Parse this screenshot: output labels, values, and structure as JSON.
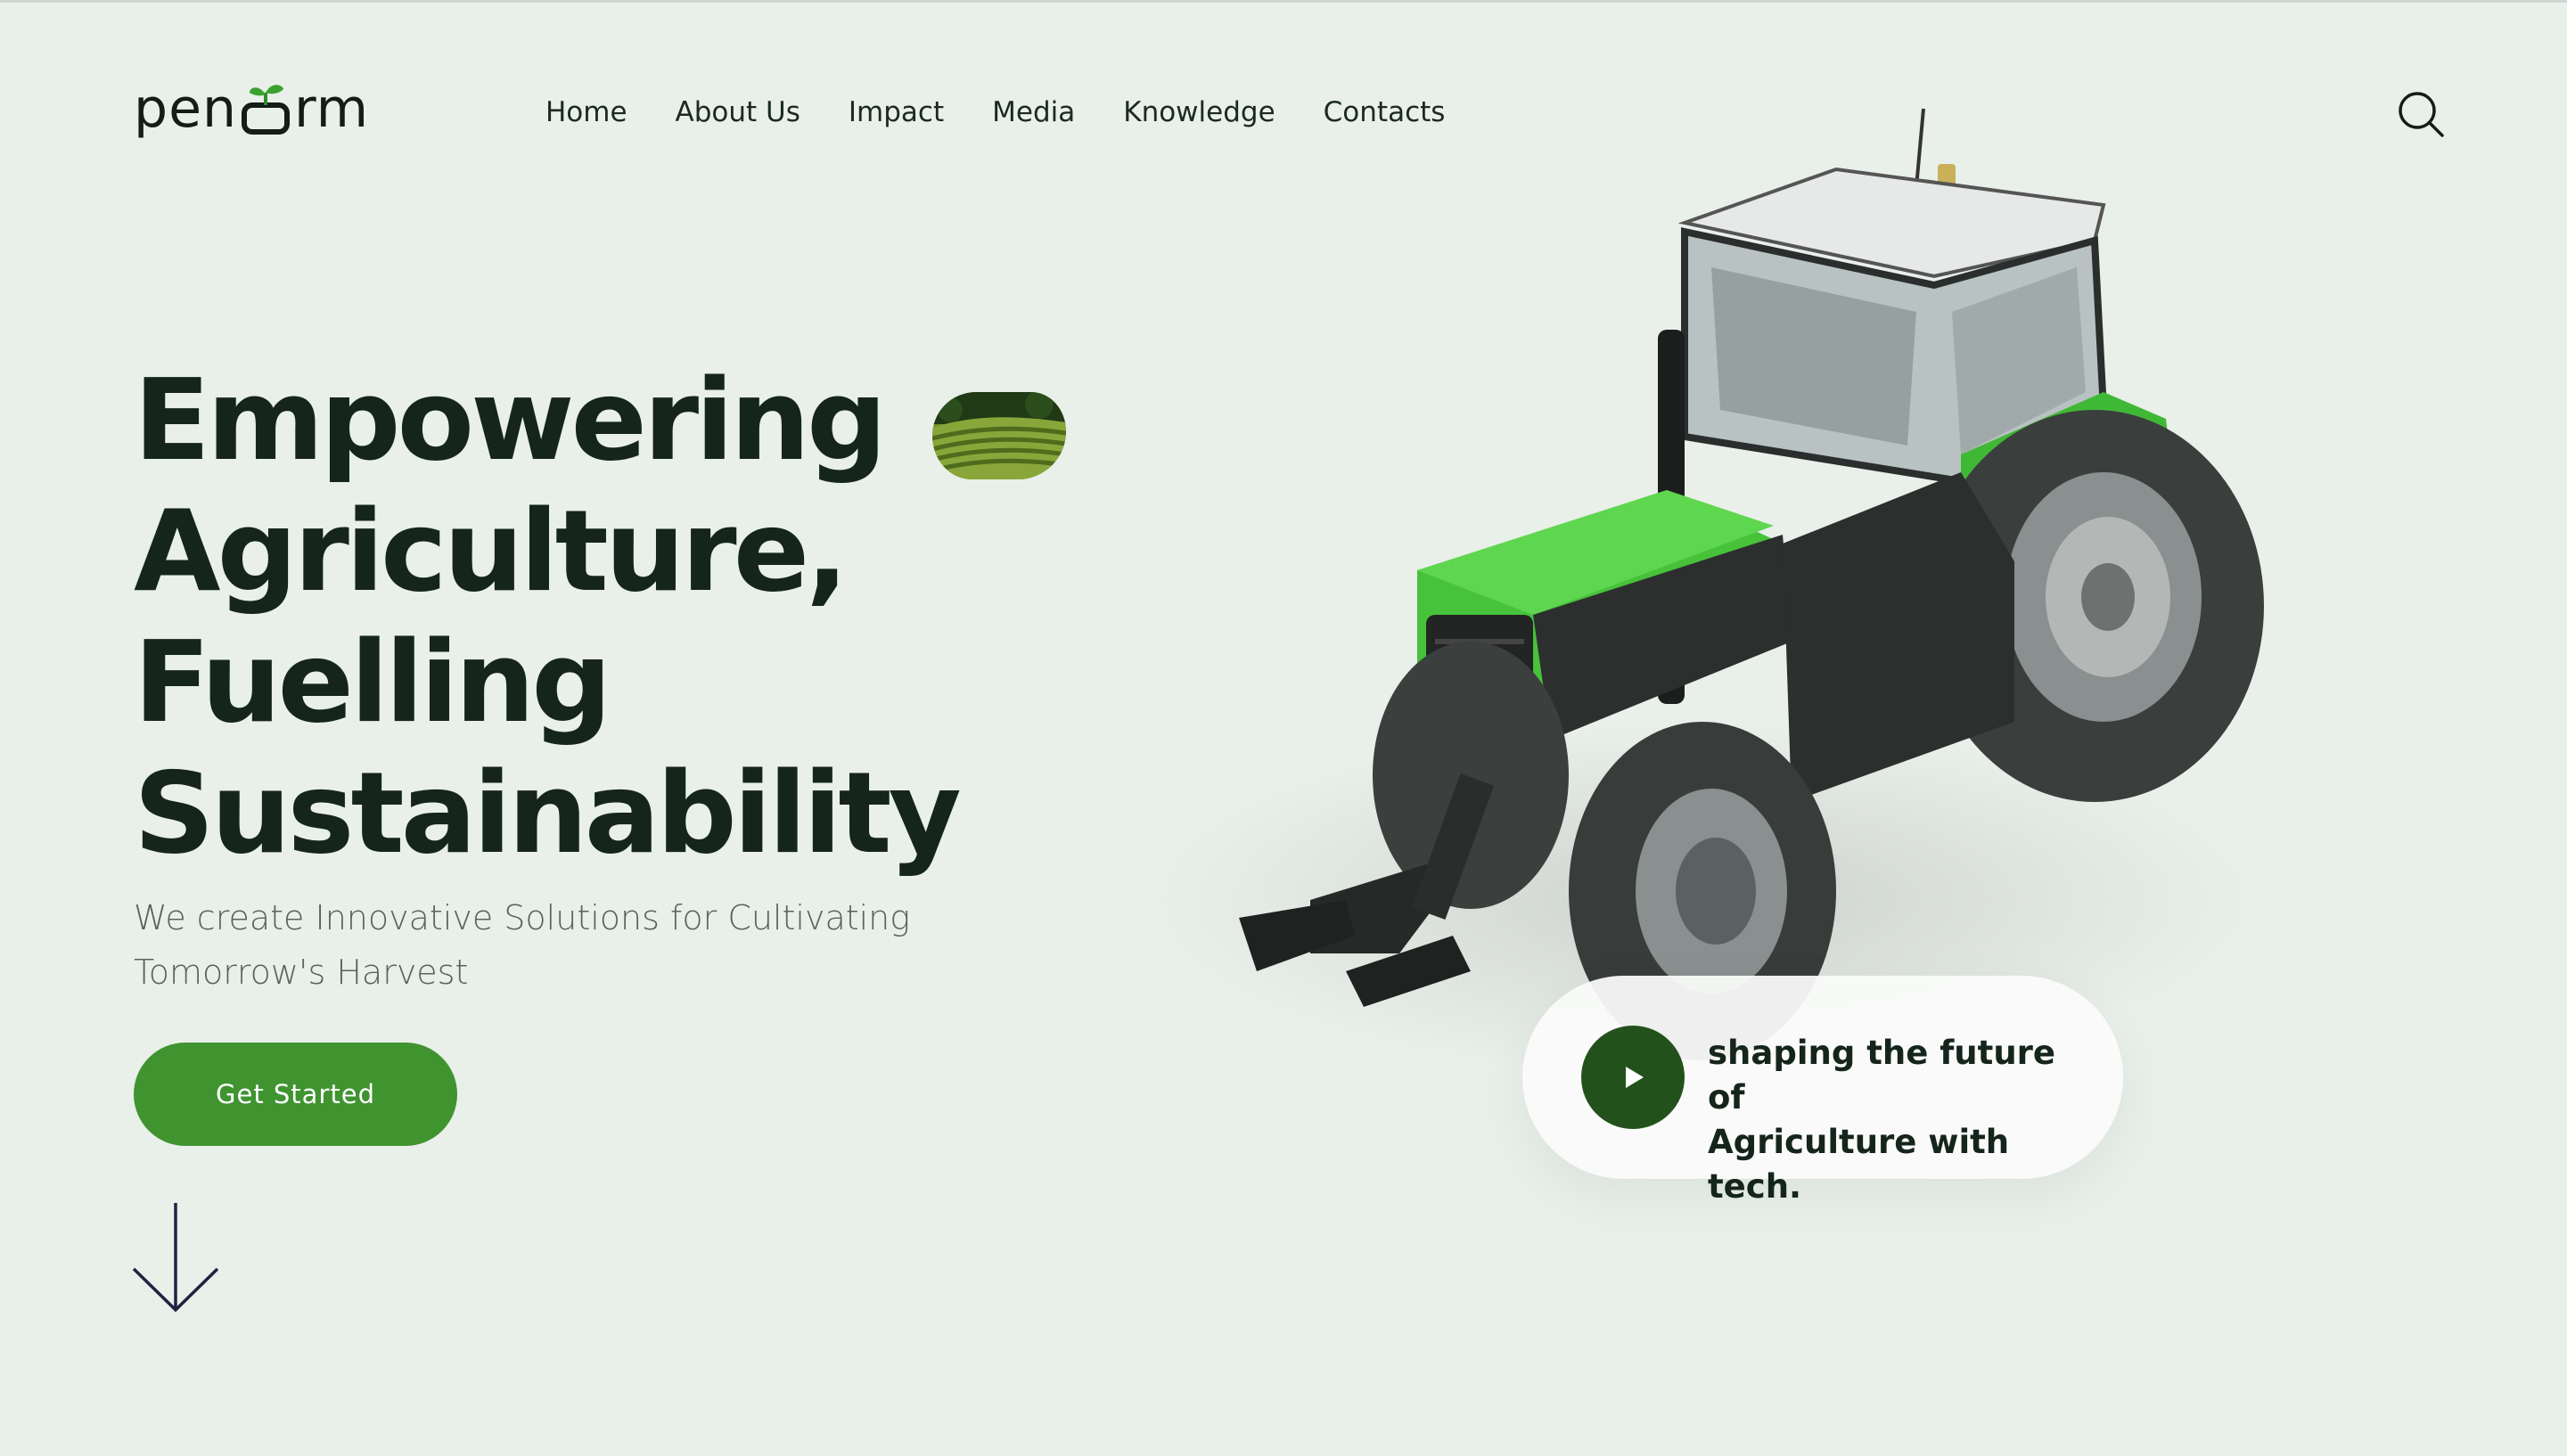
{
  "brand": {
    "logo_text_left": "pen",
    "logo_text_right": "rm"
  },
  "nav": {
    "items": [
      {
        "label": "Home"
      },
      {
        "label": "About Us"
      },
      {
        "label": "Impact"
      },
      {
        "label": "Media"
      },
      {
        "label": "Knowledge"
      },
      {
        "label": "Contacts"
      }
    ]
  },
  "icons": {
    "search": "search-icon",
    "play": "play-icon",
    "scroll": "arrow-down-icon"
  },
  "hero": {
    "headline_lines": [
      "Empowering",
      "Agriculture,",
      "Fuelling",
      "Sustainability"
    ],
    "subtitle_line1": "We create Innovative Solutions for Cultivating",
    "subtitle_line2": "Tomorrow's Harvest",
    "cta_label": "Get Started"
  },
  "video": {
    "line1": "shaping the future of",
    "line2": "Agriculture with tech."
  },
  "colors": {
    "background": "#e9efe9",
    "primary_green": "#3f9430",
    "dark_green": "#23511c",
    "tractor_green": "#4cc13c",
    "text_dark": "#15251c"
  }
}
